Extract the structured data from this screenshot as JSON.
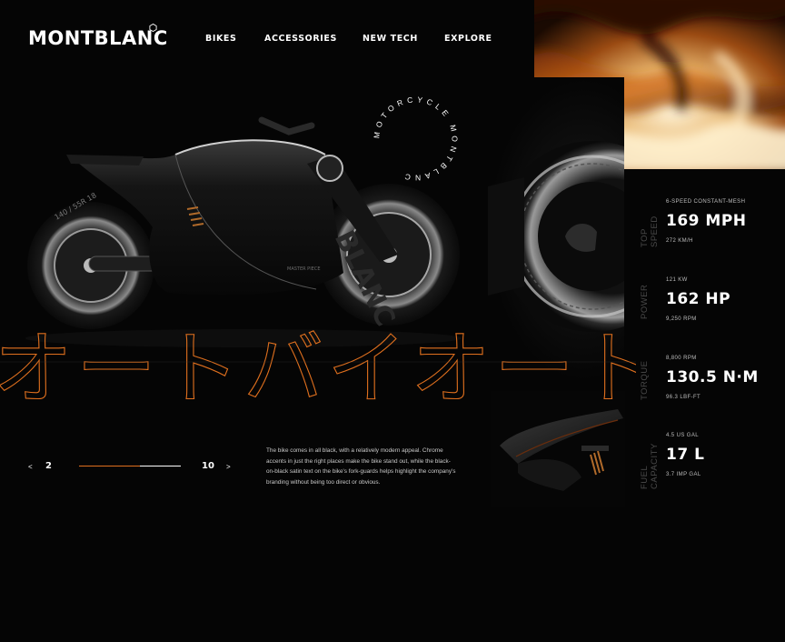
{
  "brand": {
    "name": "MONTBLANC"
  },
  "nav": {
    "items": [
      {
        "label": "BIKES"
      },
      {
        "label": "ACCESSORIES"
      },
      {
        "label": "NEW TECH"
      },
      {
        "label": "EXPLORE"
      }
    ]
  },
  "hero": {
    "circle_text": "MOTORCYCLE MONTBLANC",
    "kanji": "オートバイオート",
    "bike_text": {
      "fairing": "BLANC",
      "tire": "140 / 55R 18",
      "panel": "MASTER PIECE"
    }
  },
  "specs": [
    {
      "label": "TOP SPEED",
      "top": "6-SPEED CONSTANT-MESH",
      "value": "169 MPH",
      "bottom": "272 KM/H"
    },
    {
      "label": "POWER",
      "top": "121 KW",
      "value": "162 HP",
      "bottom": "9,250 RPM"
    },
    {
      "label": "TORQUE",
      "top": "8,800 RPM",
      "value": "130.5 N·M",
      "bottom": "96.3 LBF-FT"
    },
    {
      "label": "FUEL CAPACITY",
      "top": "4.5 US GAL",
      "value": "17 L",
      "bottom": "3.7 IMP GAL"
    }
  ],
  "pager": {
    "prev": "<",
    "next": ">",
    "current": "2",
    "total": "10",
    "progress": 0.6
  },
  "description": "The bike comes in all black, with a relatively modern appeal. Chrome accents in just the right places make the bike stand out, while the black-on-black satin text on the bike's fork-guards helps highlight the company's branding without being too direct or obvious.",
  "colors": {
    "accent": "#e0701e",
    "background": "#050505",
    "muted": "#4a4a4a"
  },
  "icons": {
    "logo_mark": "hexagon-icon"
  }
}
